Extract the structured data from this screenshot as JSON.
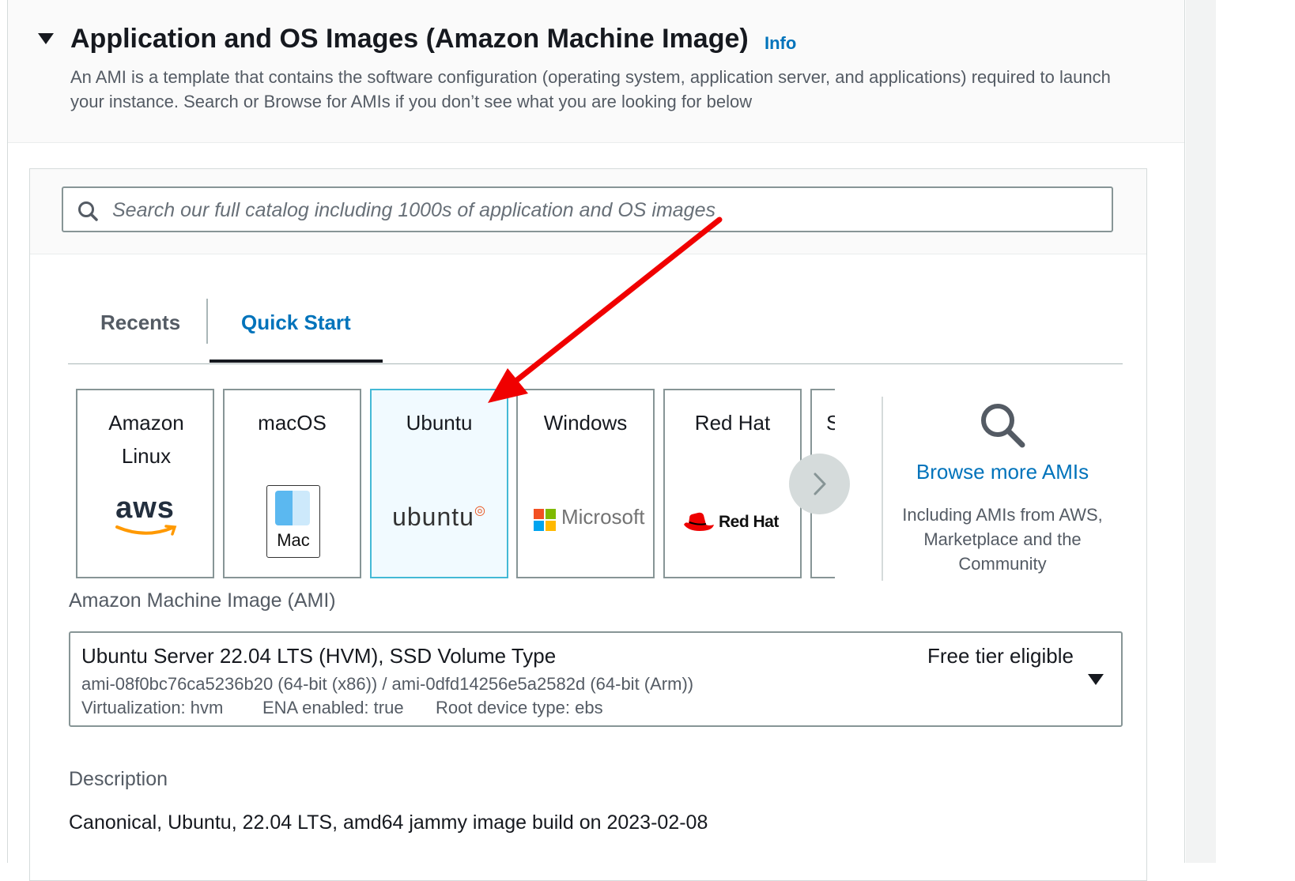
{
  "section": {
    "title": "Application and OS Images (Amazon Machine Image)",
    "info_link": "Info",
    "description": "An AMI is a template that contains the software configuration (operating system, application server, and applications) required to launch your instance. Search or Browse for AMIs if you don’t see what you are looking for below"
  },
  "search": {
    "placeholder": "Search our full catalog including 1000s of application and OS images"
  },
  "tabs": [
    {
      "label": "Recents",
      "active": false
    },
    {
      "label": "Quick Start",
      "active": true
    }
  ],
  "quick_start_tiles": [
    {
      "label": "Amazon Linux",
      "logo": "aws",
      "selected": false
    },
    {
      "label": "macOS",
      "logo": "Mac",
      "selected": false
    },
    {
      "label": "Ubuntu",
      "logo": "ubuntu",
      "selected": true
    },
    {
      "label": "Windows",
      "logo": "Microsoft",
      "selected": false
    },
    {
      "label": "Red Hat",
      "logo": "Red Hat",
      "selected": false
    },
    {
      "label": "S",
      "logo": "",
      "selected": false
    }
  ],
  "browse": {
    "link": "Browse more AMIs",
    "subtitle": "Including AMIs from AWS, Marketplace and the Community"
  },
  "ami": {
    "label": "Amazon Machine Image (AMI)",
    "selected_name": "Ubuntu Server 22.04 LTS (HVM), SSD Volume Type",
    "badge": "Free tier eligible",
    "ids": "ami-08f0bc76ca5236b20 (64-bit (x86)) / ami-0dfd14256e5a2582d (64-bit (Arm))",
    "virtualization": "Virtualization: hvm",
    "ena": "ENA enabled: true",
    "root_device": "Root device type: ebs"
  },
  "description": {
    "label": "Description",
    "value": "Canonical, Ubuntu, 22.04 LTS, amd64 jammy image build on 2023-02-08"
  },
  "colors": {
    "link_blue": "#0073bb",
    "selected_tile_border": "#44b9d6",
    "selected_tile_bg": "#f1faff",
    "annotation_arrow": "#f00000"
  }
}
